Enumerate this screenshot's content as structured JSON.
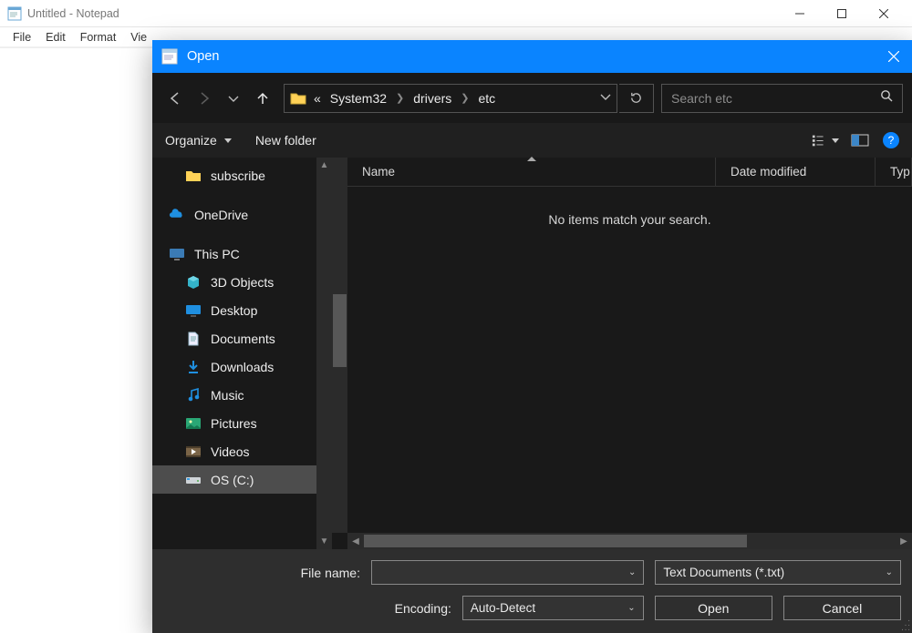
{
  "notepad": {
    "title": "Untitled - Notepad",
    "menu": {
      "file": "File",
      "edit": "Edit",
      "format": "Format",
      "view": "Vie"
    }
  },
  "dialog": {
    "title": "Open",
    "breadcrumb": {
      "prefix": "«",
      "seg1": "System32",
      "seg2": "drivers",
      "seg3": "etc"
    },
    "search_placeholder": "Search etc",
    "toolbar": {
      "organize": "Organize",
      "new_folder": "New folder"
    },
    "tree": {
      "subscribe": "subscribe",
      "onedrive": "OneDrive",
      "this_pc": "This PC",
      "objects3d": "3D Objects",
      "desktop": "Desktop",
      "documents": "Documents",
      "downloads": "Downloads",
      "music": "Music",
      "pictures": "Pictures",
      "videos": "Videos",
      "os_c": "OS (C:)"
    },
    "columns": {
      "name": "Name",
      "date": "Date modified",
      "type": "Typ"
    },
    "empty_msg": "No items match your search.",
    "filename_label": "File name:",
    "filename_value": "",
    "filetype_value": "Text Documents (*.txt)",
    "encoding_label": "Encoding:",
    "encoding_value": "Auto-Detect",
    "open_btn": "Open",
    "cancel_btn": "Cancel",
    "help": "?"
  }
}
